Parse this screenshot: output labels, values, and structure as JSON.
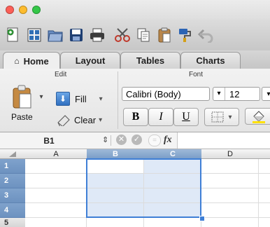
{
  "window": {
    "traffic_lights": [
      "#fc5f57",
      "#fdbc2e",
      "#34c748"
    ]
  },
  "toolbar": {
    "icons": [
      "new-document-icon",
      "gallery-icon",
      "open-icon",
      "save-icon",
      "print-icon",
      "cut-icon",
      "copy-icon",
      "paste-icon",
      "format-painter-icon",
      "undo-icon"
    ]
  },
  "tabs": [
    {
      "label": "Home",
      "active": true
    },
    {
      "label": "Layout"
    },
    {
      "label": "Tables"
    },
    {
      "label": "Charts"
    }
  ],
  "ribbon": {
    "edit_group_label": "Edit",
    "font_group_label": "Font",
    "paste_label": "Paste",
    "fill_label": "Fill",
    "clear_label": "Clear",
    "font_name": "Calibri (Body)",
    "font_size": "12",
    "bold": "B",
    "italic": "I",
    "underline": "U"
  },
  "formula_bar": {
    "name_box": "B1",
    "fx": "fx"
  },
  "sheet": {
    "columns": [
      "A",
      "B",
      "C",
      "D"
    ],
    "rows": [
      "1",
      "2",
      "3",
      "4",
      "5"
    ],
    "selected_range": "B1:C4"
  }
}
